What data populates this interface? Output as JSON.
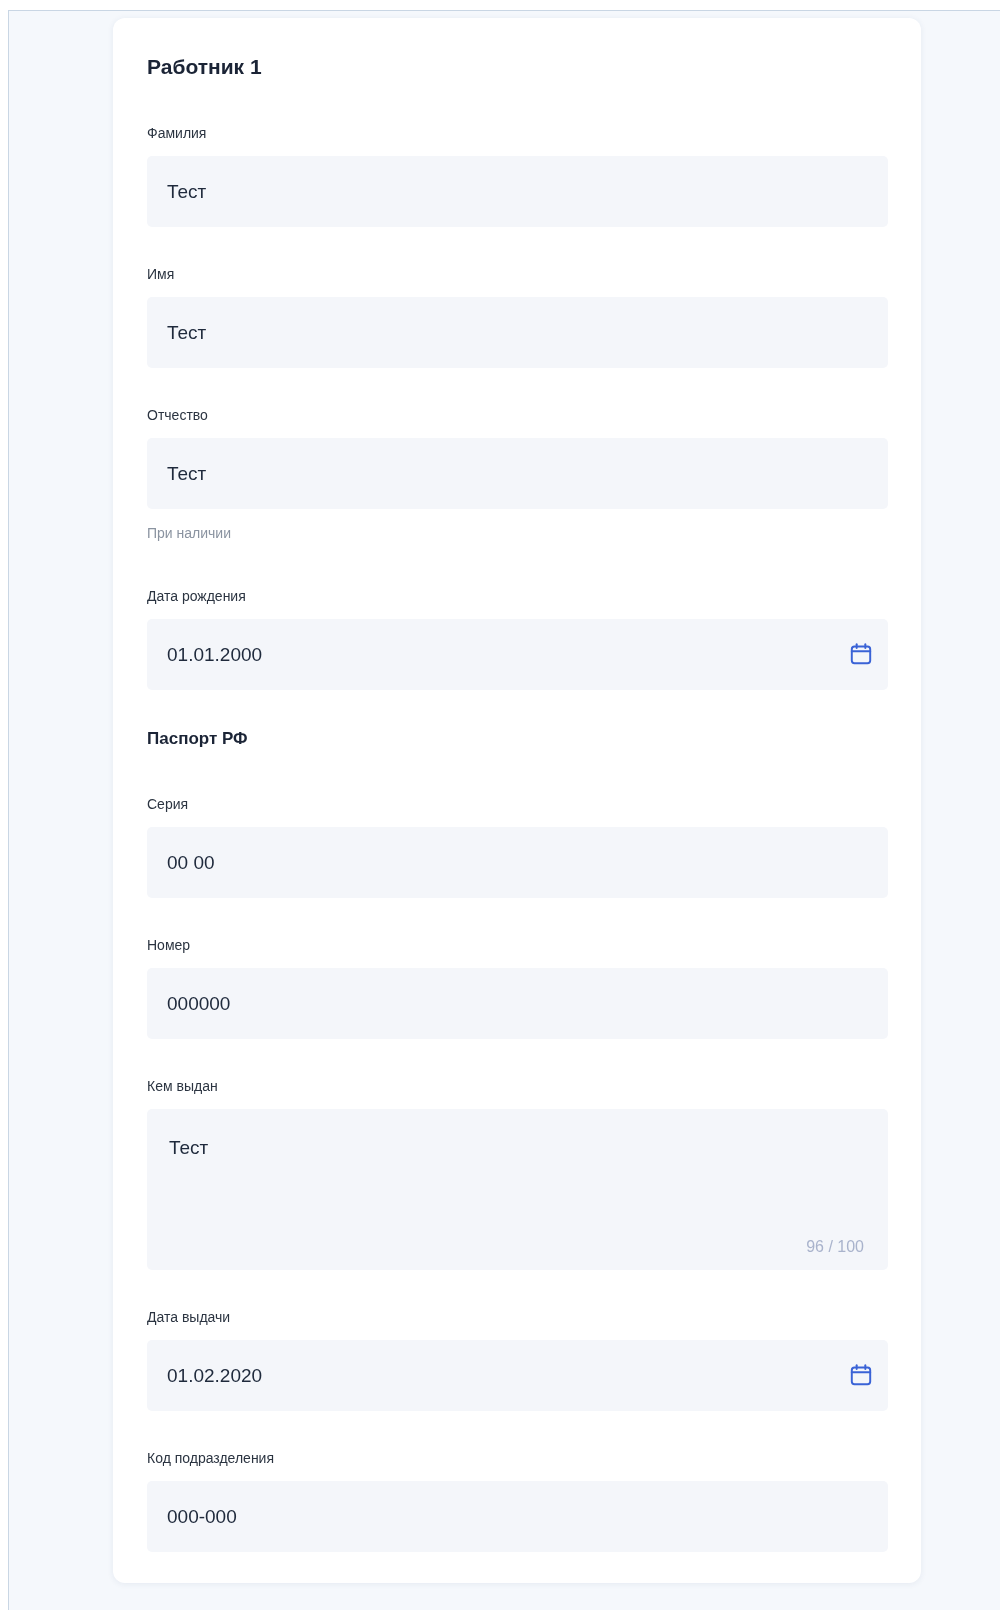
{
  "card": {
    "title": "Работник 1",
    "items": [
      {
        "kind": "text",
        "label": "Фамилия",
        "value": "Тест"
      },
      {
        "kind": "text",
        "label": "Имя",
        "value": "Тест"
      },
      {
        "kind": "text",
        "label": "Отчество",
        "value": "Тест",
        "hint": "При наличии"
      },
      {
        "kind": "date",
        "label": "Дата рождения",
        "value": "01.01.2000"
      },
      {
        "kind": "heading",
        "text": "Паспорт РФ"
      },
      {
        "kind": "text",
        "label": "Серия",
        "value": "00 00"
      },
      {
        "kind": "text",
        "label": "Номер",
        "value": "000000"
      },
      {
        "kind": "textarea",
        "label": "Кем выдан",
        "value": "Тест",
        "counter": "96 / 100"
      },
      {
        "kind": "date",
        "label": "Дата выдачи",
        "value": "01.02.2020"
      },
      {
        "kind": "text",
        "label": "Код подразделения",
        "value": "000-000"
      }
    ]
  }
}
